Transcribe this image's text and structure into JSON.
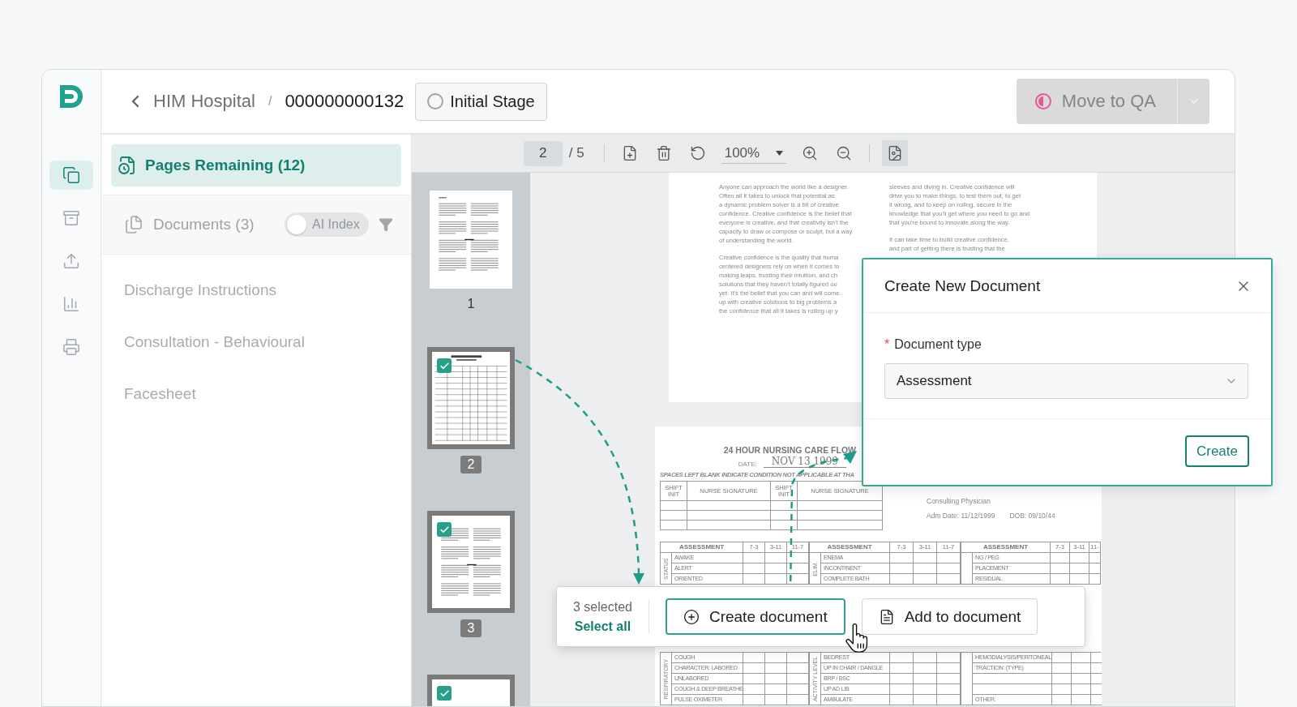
{
  "sidebar": {
    "items": [
      {
        "kind": "pages",
        "selected": true
      },
      {
        "kind": "archive",
        "selected": false
      },
      {
        "kind": "upload",
        "selected": false
      },
      {
        "kind": "chart",
        "selected": false
      },
      {
        "kind": "fax",
        "selected": false
      }
    ]
  },
  "header": {
    "breadcrumb": [
      "HIM Hospital",
      "/",
      "000000000132"
    ],
    "stage": "Initial Stage",
    "move_button": {
      "label": "Move to QA",
      "disabled": true
    }
  },
  "left_panel": {
    "pages_tab": {
      "label": "Pages Remaining (12)",
      "selected": true
    },
    "documents_label": "Documents (3)",
    "ai_index": {
      "label": "AI Index",
      "on": false
    },
    "documents": [
      "Discharge Instructions",
      "Consultation - Behavioural",
      "Facesheet"
    ]
  },
  "toolbar": {
    "page": "2",
    "total": "/ 5",
    "zoom": "100%"
  },
  "thumbnails": [
    {
      "kind": "text",
      "label": "1",
      "checked": false
    },
    {
      "kind": "form",
      "label": "2",
      "checked": true
    },
    {
      "kind": "text",
      "label": "3",
      "checked": true
    },
    {
      "kind": "blank",
      "checked": true
    }
  ],
  "text_page": {
    "columns": [
      [
        [
          "Anyone can approach the world like a designer.",
          "Often all it takes to unlock that potential as",
          "a dynamic problem solver is a bit of creative",
          "confidence. Creative confidence is the belief that",
          "everyone is creative, and that creativity isn’t the",
          "capacity to draw or compose or sculpt, but a way",
          "of understanding the world."
        ],
        [
          "Creative confidence is the quality that huma",
          "centered designers rely on when it comes to",
          "making leaps, trusting their intuition, and ch",
          "solutions that they haven’t totally figured ou",
          "yet. It’s the belief that you can and will come",
          "up with creative solutions to big problems a",
          "the confidence that all it takes is rolling up y"
        ]
      ],
      [
        [
          "sleeves and diving in. Creative confidence will",
          "drive you to make things, to test them out, to get",
          "it wrong, and to keep on rolling, secure in the",
          "knowledge that you’ll get where you need to go and",
          "that you’re bound to innovate along the way."
        ],
        [
          "It can take time to build creative confidence,",
          "and part of getting there is trusting that the"
        ]
      ]
    ]
  },
  "form_page": {
    "title": "24 HOUR NURSING CARE FLOW",
    "date_label": "DATE:",
    "date": "NOV 13 1999",
    "note": "SPACES LEFT BLANK INDICATE CONDITION NOT APPLICABLE AT THA",
    "signature_headers": [
      "SHIFT INIT",
      "NURSE SIGNATURE",
      "SHIFT INIT",
      "NURSE SIGNATURE"
    ],
    "physician": "Consulting Physician",
    "adm_date": "Adm Date: 11/12/1999",
    "dob": "DOB: 09/10/44",
    "upper_blocks": [
      {
        "header": "ASSESSMENT",
        "shifts": [
          "7-3",
          "3-11",
          "11-7"
        ],
        "side": "STATUS",
        "rows": [
          "AWAKE",
          "ALERT",
          "ORIENTED"
        ]
      },
      {
        "header": "ASSESSMENT",
        "shifts": [
          "7-3",
          "3-11",
          "11-7"
        ],
        "side": "ELIM.",
        "rows": [
          "ENEMA",
          "INCONTINENT",
          "COMPLETE BATH"
        ]
      },
      {
        "header": "ASSESSMENT",
        "shifts": [
          "7-3",
          "3-11",
          "11-"
        ],
        "rows": [
          "NG / PEG",
          "PLACEMENT",
          "RESIDUAL"
        ]
      }
    ],
    "lower_blocks": [
      {
        "side": "RESPIRATORY",
        "rows": [
          "COUGH",
          "CHARACTER: LABORED",
          "UNLABORED",
          "COUGH & DEEP BREATHE",
          "PULSE OXIMETER"
        ]
      },
      {
        "side": "ACTIVITY LEVEL",
        "rows": [
          "BEDREST",
          "UP IN CHAIR / DANGLE",
          "BRP / BSC",
          "UP AD LIB",
          "AMBULATE"
        ]
      },
      {
        "rows": [
          "HEMODIALYSIS/PERITONEAL",
          "TRACTION: (TYPE)",
          "OTHER:"
        ]
      }
    ]
  },
  "modal": {
    "title": "Create New Document",
    "required_mark": "*",
    "field_label": "Document type",
    "value": "Assessment",
    "button": "Create"
  },
  "selection_bar": {
    "count": "3 selected",
    "select_all": "Select all",
    "create": "Create document",
    "add": "Add to document"
  }
}
